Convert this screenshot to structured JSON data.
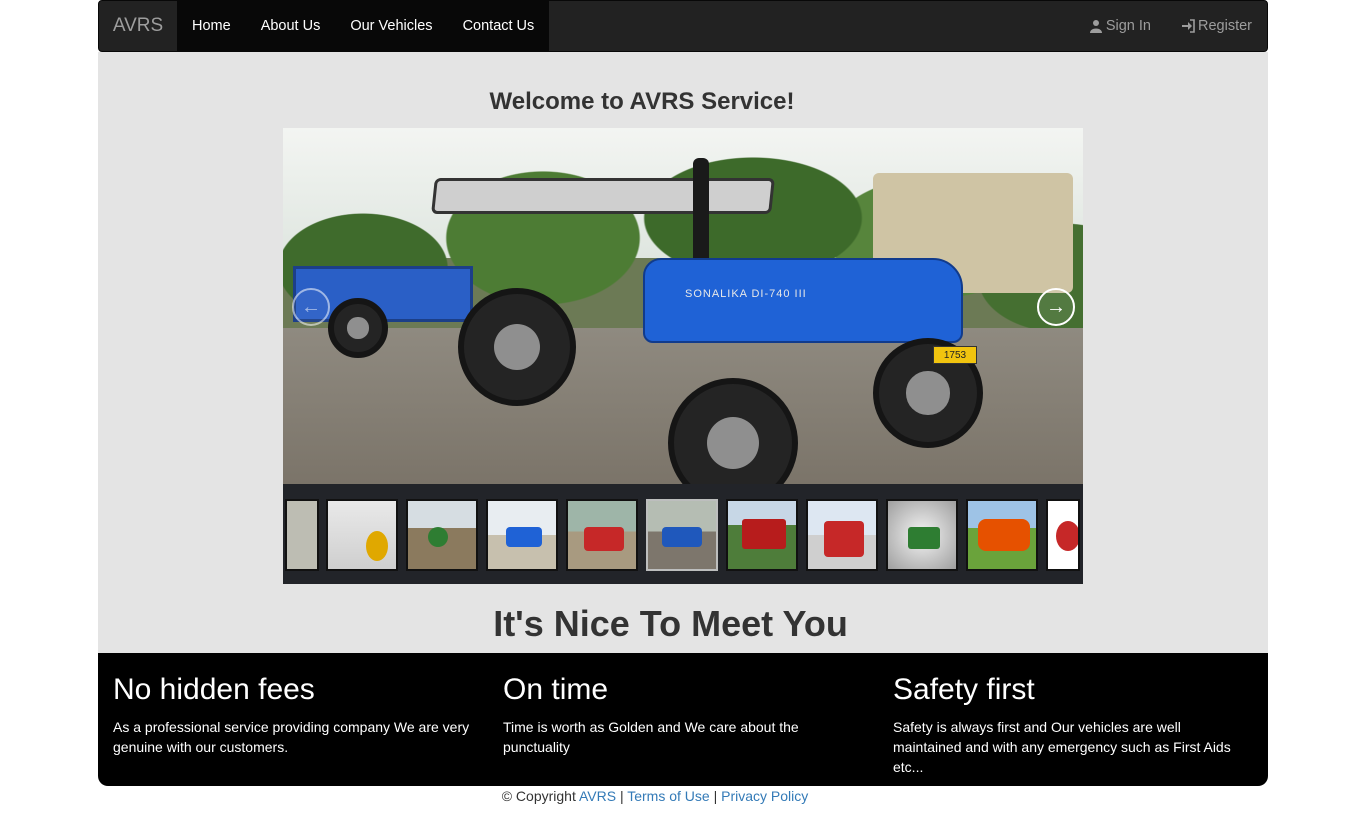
{
  "navbar": {
    "brand": "AVRS",
    "links": [
      "Home",
      "About Us",
      "Our Vehicles",
      "Contact Us"
    ],
    "right": {
      "signin": "Sign In",
      "register": "Register"
    }
  },
  "hero": {
    "welcome": "Welcome to AVRS Service!",
    "slide_hood_text": "SONALIKA   DI-740 III",
    "plate": "1753"
  },
  "section": {
    "heading": "It's Nice To Meet You"
  },
  "features": [
    {
      "title": "No hidden fees",
      "text": "As a professional service providing company We are very genuine with our customers."
    },
    {
      "title": "On time",
      "text": "Time is worth as Golden and We care about the punctuality"
    },
    {
      "title": "Safety first",
      "text": "Safety is always first and Our vehicles are well maintained and with any emergency such as First Aids etc..."
    }
  ],
  "footer": {
    "copyright": "© Copyright",
    "brand": "AVRS",
    "sep": "|",
    "terms": "Terms of Use",
    "privacy": "Privacy Policy"
  },
  "colors": {
    "navbar": "#222222",
    "link": "#337ab7",
    "panel": "#e4e4e4"
  }
}
